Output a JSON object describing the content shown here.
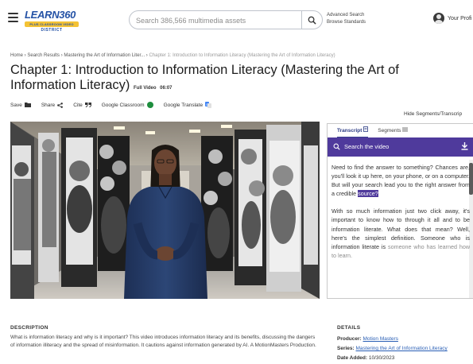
{
  "header": {
    "logo": {
      "word": "LEARN360",
      "bar": "PLUS CLASSROOM VIDEO",
      "sub": "DISTRICT"
    },
    "search_placeholder": "Search 386,566 multimedia assets",
    "advanced_search": "Advanced Search",
    "browse_standards": "Browse Standards",
    "profile_label": "Your Profi"
  },
  "breadcrumb": {
    "items": [
      "Home",
      "Search Results",
      "Mastering the Art of Information Liter..."
    ],
    "separator": " › ",
    "current": "Chapter 1: Introduction to Information Literacy (Mastering the Art of Information Literacy)"
  },
  "title": {
    "text": "Chapter 1: Introduction to Information Literacy (Mastering the Art of Information Literacy)",
    "type": "Full Video",
    "duration": "06:07"
  },
  "actions": {
    "save": "Save",
    "share": "Share",
    "cite": "Cite",
    "google_classroom": "Google Classroom",
    "google_translate": "Google Translate",
    "hide_segments": "Hide Segments/Transcrip"
  },
  "transcript": {
    "tabs": [
      "Transcript",
      "Segments"
    ],
    "active_tab": 0,
    "search_label": "Search the video",
    "p1_before": "Need to find the answer to something? Chances are, you'll look it up here, on your phone, or on a computer. But will your search lead you to the right answer from a credible ",
    "p1_highlight": "source?",
    "p2": "With so much information just two click away, it's important to know how to through it all and to be information literate. What does that mean? Well, here's the simplest definition. Someone who is information literate is",
    "p2_faded": "someone who has learned how to learn."
  },
  "description": {
    "heading": "DESCRIPTION",
    "text": "What is information literacy and why is it important? This video introduces information literacy and its benefits, discussing the dangers of information illiteracy and the spread of misinformation. It cautions against information generated by AI. A MotionMasters Production."
  },
  "details": {
    "heading": "DETAILS",
    "producer_label": "Producer:",
    "producer": "Motion Masters",
    "series_label": "Series:",
    "series": "Mastering the Art of Information Literacy",
    "date_label": "Date Added:",
    "date": "10/30/2023"
  },
  "colors": {
    "accent_purple": "#4f3a9c",
    "logo_blue": "#2452a5",
    "logo_yellow": "#f4c234",
    "google_classroom_green": "#1e8e3e",
    "link_blue": "#2a5fb5"
  }
}
